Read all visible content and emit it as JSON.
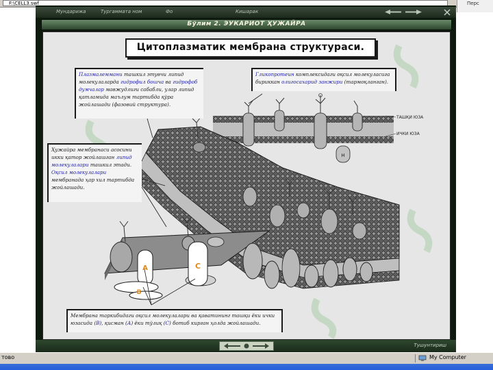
{
  "browser": {
    "address": "F:\\CELL3.swf",
    "right_pane_text": "Перс"
  },
  "menu": {
    "items": [
      "Мундарижа",
      "Тургаммата ном",
      "Фо",
      "Кишарак"
    ]
  },
  "title_bar": "Бўлим 2.  ЭУКАРИОТ ҲУЖАЙРА",
  "banner": "Цитоплазматик мембрана структураси.",
  "annotations": {
    "top_left": {
      "parts": [
        {
          "t": "Плазмалеммани",
          "h": true
        },
        {
          "t": " ташкил этувчи липид молекулаларда ",
          "h": false
        },
        {
          "t": "гидрофил бошча",
          "h": true
        },
        {
          "t": " ва ",
          "h": false
        },
        {
          "t": "гидрофоб думчалар",
          "h": true
        },
        {
          "t": " мавжудлиги сабабли, улар липид қатламида маълум тартибда қўра жойлашади (фазовий структура).",
          "h": false
        }
      ]
    },
    "top_right": {
      "parts": [
        {
          "t": "Гликопротеин",
          "h": true
        },
        {
          "t": " комплексидаги оқсил молекуласига бириккан ",
          "h": false
        },
        {
          "t": "олигосахарид занжири",
          "h": true
        },
        {
          "t": " (тармоқланган).",
          "h": false
        }
      ]
    },
    "mid_left": {
      "parts": [
        {
          "t": "Ҳужайра мембранаси асосини икки қатор жойлашган ",
          "h": false
        },
        {
          "t": "липид молекулалари",
          "h": true
        },
        {
          "t": " ташкил этади. ",
          "h": false
        },
        {
          "t": "Оқсил молекулалари",
          "h": true
        },
        {
          "t": " мембранада ҳар хил тартибда жойлашади.",
          "h": false
        }
      ]
    },
    "bottom": {
      "parts": [
        {
          "t": "Мембрана таркибидаги оқсил молекулалари ва қаватининг ташқи ёки ички юзасида (",
          "h": false
        },
        {
          "t": "В",
          "h": true
        },
        {
          "t": "), қисман (",
          "h": false
        },
        {
          "t": "А",
          "h": true
        },
        {
          "t": ") ёки тўлиқ (",
          "h": false
        },
        {
          "t": "С",
          "h": true
        },
        {
          "t": ") ботиб кирган ҳолда жойлашади.",
          "h": false
        }
      ]
    }
  },
  "diagram_labels": {
    "outer_surface": "ТАШҚИ ЮЗА",
    "inner_surface": "ИЧКИ ЮЗА",
    "protein_a": "А",
    "protein_b": "В",
    "protein_c": "С"
  },
  "bottom_nav": {
    "right_button": "Тушунтириш"
  },
  "status": {
    "left": "тово",
    "right": "My Computer"
  },
  "colors": {
    "highlight_text": "#1a1aa8",
    "protein_label": "#e08a1a",
    "frame": "#0e1a0e"
  }
}
